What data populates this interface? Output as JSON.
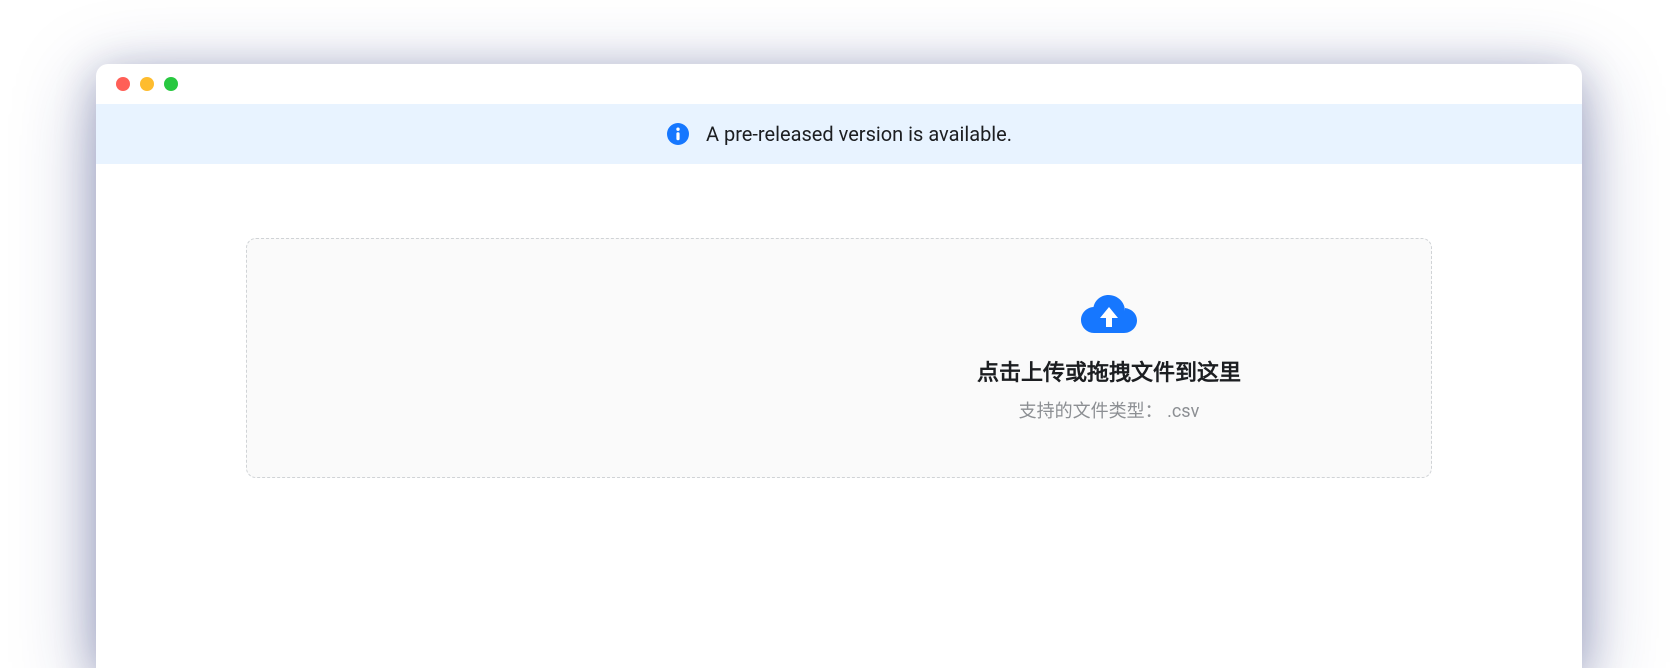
{
  "alert": {
    "message": "A pre-released version is available."
  },
  "upload": {
    "title": "点击上传或拖拽文件到这里",
    "subtitle": "支持的文件类型： .csv"
  },
  "colors": {
    "accent": "#1677ff",
    "alert_bg": "#e8f3ff"
  }
}
